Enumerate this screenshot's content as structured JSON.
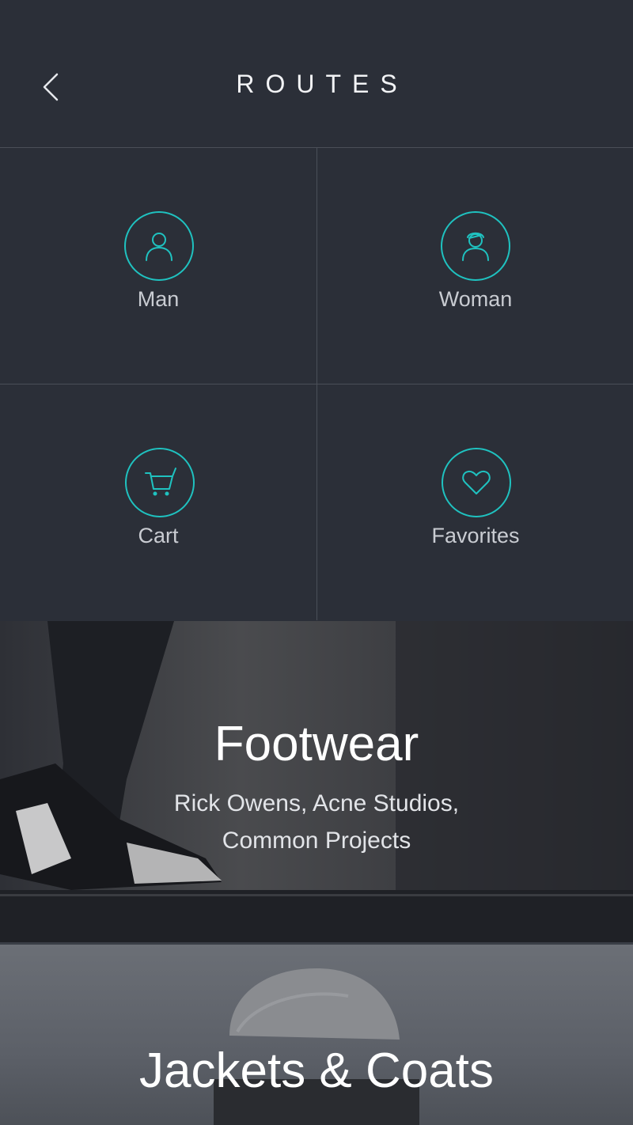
{
  "header": {
    "title": "ROUTES",
    "back_icon": "chevron-left-icon"
  },
  "accent_color": "#1fc2c0",
  "categories": [
    {
      "label": "Man",
      "icon": "man-icon"
    },
    {
      "label": "Woman",
      "icon": "woman-icon"
    },
    {
      "label": "Cart",
      "icon": "cart-icon"
    },
    {
      "label": "Favorites",
      "icon": "heart-icon"
    }
  ],
  "banners": [
    {
      "title": "Footwear",
      "subtitle_line1": "Rick Owens, Acne Studios,",
      "subtitle_line2": "Common Projects"
    },
    {
      "title": "Jackets & Coats"
    }
  ]
}
